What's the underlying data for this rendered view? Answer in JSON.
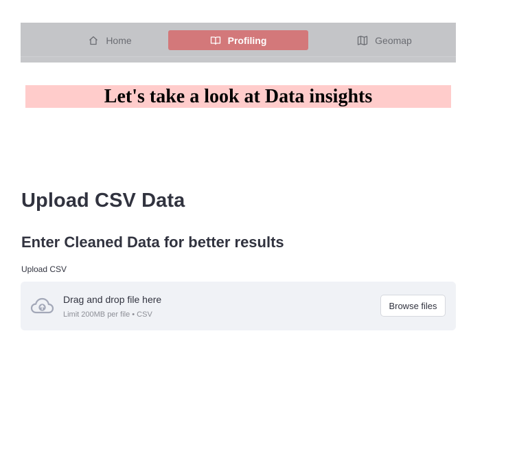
{
  "navbar": {
    "items": [
      {
        "label": "Home",
        "icon": "home-icon",
        "active": false
      },
      {
        "label": "Profiling",
        "icon": "book-icon",
        "active": true
      },
      {
        "label": "Geomap",
        "icon": "map-icon",
        "active": false
      }
    ],
    "active_color": "#d3787a",
    "background_color": "#c4c5c8"
  },
  "banner": {
    "text": "Let's take a look at Data insights",
    "background_color": "#ffcccb"
  },
  "main": {
    "title": "Upload CSV Data",
    "subtitle": "Enter Cleaned Data for better results"
  },
  "uploader": {
    "label": "Upload CSV",
    "instruction": "Drag and drop file here",
    "limit_text": "Limit 200MB per file • CSV",
    "browse_label": "Browse files",
    "icon": "cloud-upload-icon"
  }
}
